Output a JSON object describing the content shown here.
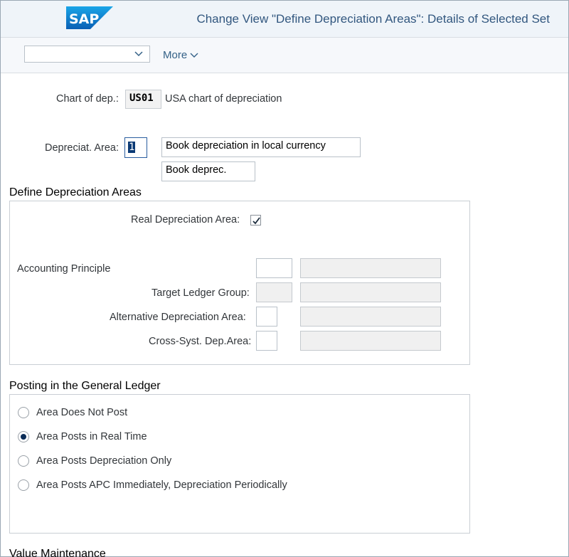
{
  "header": {
    "logo_text": "SAP",
    "title": "Change View \"Define Depreciation Areas\": Details of Selected Set"
  },
  "toolbar": {
    "select_value": "",
    "more_label": "More"
  },
  "chart_of_dep": {
    "label": "Chart of dep.:",
    "value": "US01",
    "description": "USA chart of depreciation"
  },
  "dep_area": {
    "label": "Depreciat. Area:",
    "value": "1",
    "long_text": "Book depreciation in local currency",
    "short_text": "Book deprec."
  },
  "define_section": {
    "title": "Define Depreciation Areas",
    "real_dep_label": "Real Depreciation Area:",
    "real_dep_checked": true,
    "accounting_principle_label": "Accounting Principle",
    "target_ledger_label": "Target Ledger Group:",
    "alt_dep_label": "Alternative Depreciation Area:",
    "cross_syst_label": "Cross-Syst. Dep.Area:"
  },
  "posting_section": {
    "title": "Posting in the General Ledger",
    "options": [
      {
        "label": "Area Does Not Post",
        "selected": false
      },
      {
        "label": "Area Posts in Real Time",
        "selected": true
      },
      {
        "label": "Area Posts Depreciation Only",
        "selected": false
      },
      {
        "label": "Area Posts APC Immediately, Depreciation Periodically",
        "selected": false
      }
    ]
  },
  "value_section": {
    "title": "Value Maintenance"
  },
  "colors": {
    "sap_blue": "#1a73c8",
    "title_blue": "#32577f",
    "radio_selected": "#0b2d57"
  }
}
